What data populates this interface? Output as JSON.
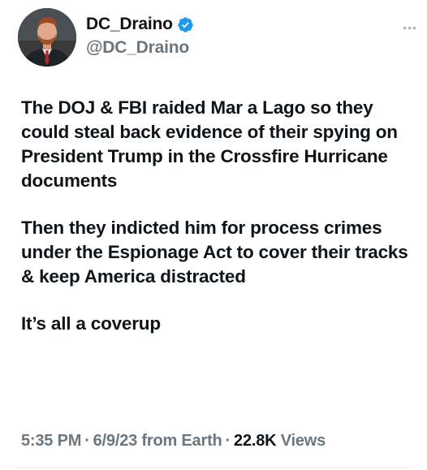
{
  "author": {
    "display_name": "DC_Draino",
    "handle": "@DC_Draino",
    "verified": true,
    "avatar_icon": "profile-photo"
  },
  "more_icon": "more-options-icon",
  "tweet": {
    "paragraphs": [
      "The DOJ & FBI raided Mar a Lago so they could steal back evidence of their spying on President Trump in the Crossfire Hurricane documents",
      "Then they indicted him for process crimes under the Espionage Act to cover their tracks & keep America distracted",
      "It’s all a coverup"
    ]
  },
  "meta": {
    "time": "5:35 PM",
    "date": "6/9/23",
    "source": "from Earth",
    "views_count": "22.8K",
    "views_label": "Views",
    "separator": "·"
  },
  "colors": {
    "text_primary": "#0f1419",
    "text_secondary": "#6e767d",
    "verified_blue": "#1d9bf0"
  }
}
